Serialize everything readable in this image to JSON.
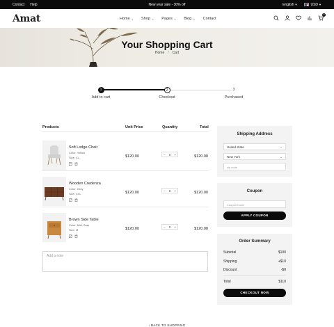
{
  "topbar": {
    "links": [
      "Contact",
      "Help"
    ],
    "promo": "New year sale - 30% off",
    "language": "English",
    "currency": "USD"
  },
  "header": {
    "logo": "Amat",
    "nav": [
      "Home",
      "Shop",
      "Pages",
      "Blog",
      "Contact"
    ],
    "cart_count": "0"
  },
  "hero": {
    "title": "Your Shopping Cart",
    "breadcrumb": [
      "Home",
      "Cart"
    ]
  },
  "steps": [
    {
      "number": "1",
      "label": "Add to cart"
    },
    {
      "number": "2",
      "label": "Checkout"
    },
    {
      "number": "3",
      "label": "Purchased"
    }
  ],
  "cart": {
    "headers": {
      "product": "Products",
      "unit_price": "Unit Price",
      "quantity": "Quantity",
      "total": "Total"
    },
    "items": [
      {
        "name": "Soft Lodge Chair",
        "color": "Color: Yellow",
        "size": "Size: XL",
        "price": "$120.00",
        "qty": "0",
        "total": "$120.00"
      },
      {
        "name": "Wooden Credenza",
        "color": "Color: Gray",
        "size": "Size: XXL",
        "price": "$120.00",
        "qty": "0",
        "total": "$120.00"
      },
      {
        "name": "Brown Side Table",
        "color": "Color: Mint Gray",
        "size": "Size: M",
        "price": "$120.00",
        "qty": "0",
        "total": "$120.00"
      }
    ],
    "note_placeholder": "Add a note"
  },
  "shipping": {
    "title": "Shipping Address",
    "country": "United State",
    "state": "New York",
    "zip_placeholder": "zip code"
  },
  "coupon": {
    "title": "Coupon",
    "code_placeholder": "Coupon Code",
    "button": "APPLY COUPON"
  },
  "summary": {
    "title": "Order Summary",
    "subtotal_label": "Subtotal",
    "subtotal": "$100",
    "shipping_label": "Shipping",
    "shipping": "+$10",
    "discount_label": "Discount",
    "discount": "-$0",
    "total_label": "Total",
    "total": "$110",
    "button": "CHECKOUT NOW"
  },
  "back_link": "BACK TO SHOPPING"
}
